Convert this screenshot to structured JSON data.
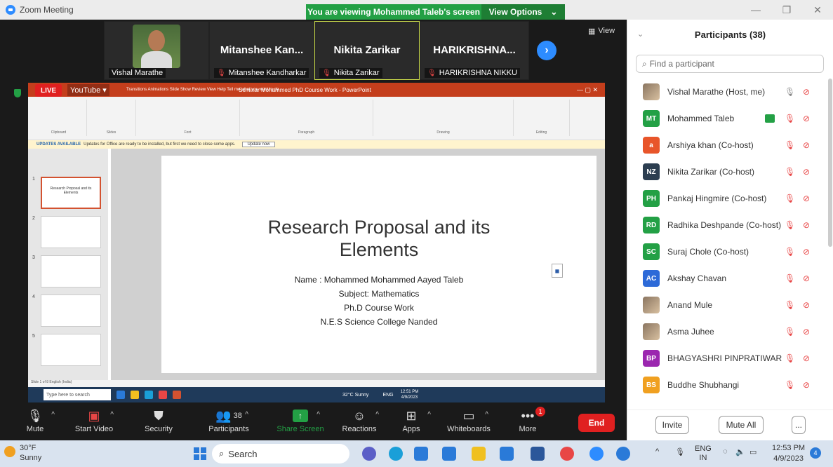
{
  "window": {
    "title": "Zoom Meeting",
    "viewing_banner": "You are viewing Mohammed Taleb's screen",
    "view_options": "View Options"
  },
  "video_strip": {
    "tiles": [
      {
        "label": "Vishal Marathe",
        "big": ""
      },
      {
        "label": "Mitanshee Kandharkar",
        "big": "Mitanshee Kan..."
      },
      {
        "label": "Nikita Zarikar",
        "big": "Nikita Zarikar"
      },
      {
        "label": "HARIKRISHNA NIKKU",
        "big": "HARIKRISHNA..."
      }
    ],
    "view_label": "View"
  },
  "shared_screen": {
    "live_label": "LIVE",
    "youtube_label": "YouTube",
    "ppt_title": "Seminar Mohammed PhD Course Work - PowerPoint",
    "ribbon_tabs": "Transitions   Animations   Slide Show   Review   View   Help   Tell me what you want to do",
    "ribbon_groups": [
      "Clipboard",
      "Slides",
      "Font",
      "Paragraph",
      "Drawing",
      "Editing"
    ],
    "update_banner_bold": "UPDATES AVAILABLE",
    "update_banner": "Updates for Office are ready to be installed, but first we need to close some apps.",
    "update_button": "Update now",
    "thumb_title": "Research Proposal and its Elements",
    "slide": {
      "title_line1": "Research Proposal and its",
      "title_line2": "Elements",
      "lines": [
        "Name : Mohammed Mohammed Aayed Taleb",
        "Subject: Mathematics",
        "Ph.D Course Work",
        "N.E.S Science College Nanded"
      ]
    },
    "status_bar": "Slide 1 of 8   English (India)",
    "inner_search": "Type here to search",
    "inner_weather": "32°C Sunny",
    "inner_lang": "ENG",
    "inner_time": "12:51 PM",
    "inner_date": "4/9/2023"
  },
  "toolbar": {
    "mute": "Mute",
    "start_video": "Start Video",
    "security": "Security",
    "participants": "Participants",
    "participants_count": "38",
    "share_screen": "Share Screen",
    "reactions": "Reactions",
    "apps": "Apps",
    "whiteboards": "Whiteboards",
    "more": "More",
    "more_badge": "1",
    "end": "End"
  },
  "participants_panel": {
    "title": "Participants (38)",
    "search_placeholder": "Find a participant",
    "items": [
      {
        "name": "Vishal Marathe (Host, me)",
        "initials": "",
        "color": "",
        "photo": true
      },
      {
        "name": "Mohammed Taleb",
        "initials": "MT",
        "color": "#23a045"
      },
      {
        "name": "Arshiya khan (Co-host)",
        "initials": "a",
        "color": "#e8552a"
      },
      {
        "name": "Nikita Zarikar (Co-host)",
        "initials": "NZ",
        "color": "#2c3e50"
      },
      {
        "name": "Pankaj Hingmire (Co-host)",
        "initials": "PH",
        "color": "#23a045"
      },
      {
        "name": "Radhika Deshpande (Co-host)",
        "initials": "RD",
        "color": "#23a045"
      },
      {
        "name": "Suraj Chole (Co-host)",
        "initials": "SC",
        "color": "#23a045"
      },
      {
        "name": "Akshay Chavan",
        "initials": "AC",
        "color": "#2d6ad8"
      },
      {
        "name": "Anand Mule",
        "initials": "",
        "color": "",
        "photo": true
      },
      {
        "name": "Asma Juhee",
        "initials": "",
        "color": "",
        "photo": true
      },
      {
        "name": "BHAGYASHRI PINPRATIWAR",
        "initials": "BP",
        "color": "#9b27af"
      },
      {
        "name": "Buddhe Shubhangi",
        "initials": "BS",
        "color": "#f0a020"
      }
    ],
    "invite": "Invite",
    "mute_all": "Mute All",
    "more": "..."
  },
  "taskbar": {
    "temp": "30°F",
    "weather": "Sunny",
    "search": "Search",
    "lang": "ENG",
    "region": "IN",
    "time": "12:53 PM",
    "date": "4/9/2023",
    "notif": "4"
  }
}
